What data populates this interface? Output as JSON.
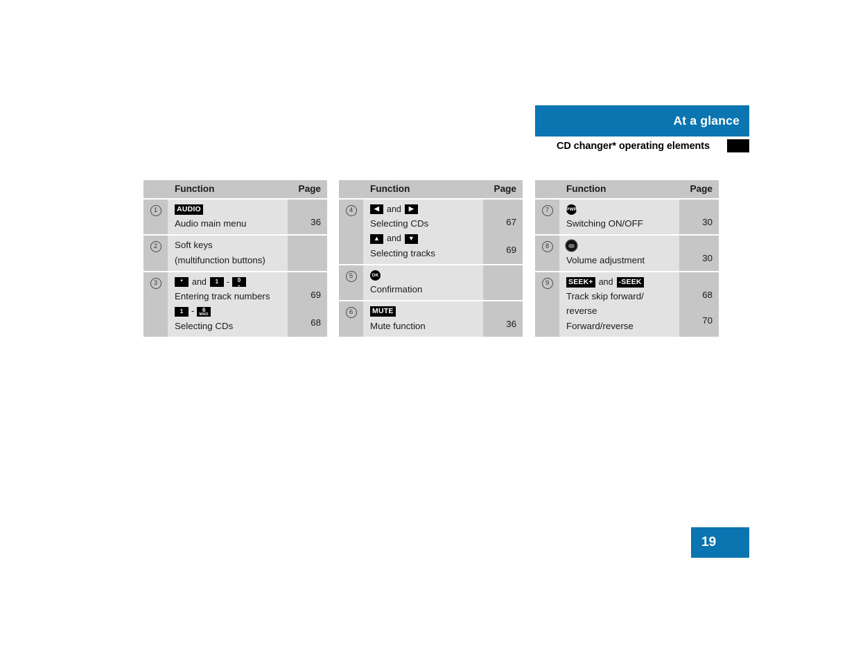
{
  "header": {
    "band_title": "At a glance",
    "subhead_title": "CD changer* operating elements",
    "accent_color": "#0a75b0"
  },
  "table_headers": {
    "function": "Function",
    "page": "Page"
  },
  "tables": [
    {
      "id": "table-1",
      "rows": [
        {
          "num": "1",
          "glyph_line": {
            "kind": "chip-text",
            "items": [
              {
                "type": "chip-text",
                "label": "AUDIO"
              }
            ]
          },
          "lines": [
            {
              "text": "Audio main menu",
              "page": "36"
            }
          ]
        },
        {
          "num": "2",
          "glyph_line": null,
          "lines": [
            {
              "text": "Soft keys",
              "page": ""
            },
            {
              "text": "(multifunction buttons)",
              "page": ""
            }
          ]
        },
        {
          "num": "3",
          "glyph_line": {
            "kind": "keys",
            "items": [
              {
                "type": "chip-key",
                "main": "*",
                "sub": ""
              },
              {
                "type": "word",
                "label": "and"
              },
              {
                "type": "chip-key",
                "main": "1",
                "sub": ""
              },
              {
                "type": "word",
                "label": "-"
              },
              {
                "type": "chip-key",
                "main": "0",
                "sub": "␣"
              }
            ]
          },
          "lines": [
            {
              "text": "Entering track numbers",
              "page": "69"
            }
          ],
          "glyph_line2": {
            "kind": "keys",
            "items": [
              {
                "type": "chip-key",
                "main": "1",
                "sub": ""
              },
              {
                "type": "word",
                "label": "-"
              },
              {
                "type": "chip-key",
                "main": "6",
                "sub": "MNO"
              }
            ]
          },
          "lines2": [
            {
              "text": "Selecting CDs",
              "page": "68"
            }
          ]
        }
      ]
    },
    {
      "id": "table-2",
      "rows": [
        {
          "num": "4",
          "glyph_line": {
            "kind": "keys",
            "items": [
              {
                "type": "chip-arrow",
                "label": "◀"
              },
              {
                "type": "word",
                "label": "and"
              },
              {
                "type": "chip-arrow",
                "label": "▶"
              }
            ]
          },
          "lines": [
            {
              "text": "Selecting CDs",
              "page": "67"
            }
          ],
          "glyph_line2": {
            "kind": "keys",
            "items": [
              {
                "type": "chip-arrow",
                "label": "▲"
              },
              {
                "type": "word",
                "label": "and"
              },
              {
                "type": "chip-arrow",
                "label": "▼"
              }
            ]
          },
          "lines2": [
            {
              "text": "Selecting tracks",
              "page": "69"
            }
          ]
        },
        {
          "num": "5",
          "glyph_line": {
            "kind": "round",
            "items": [
              {
                "type": "chip-round",
                "label": "OK"
              }
            ]
          },
          "lines": [
            {
              "text": "Confirmation",
              "page": ""
            }
          ]
        },
        {
          "num": "6",
          "glyph_line": {
            "kind": "chip-text",
            "items": [
              {
                "type": "chip-text",
                "label": "MUTE"
              }
            ]
          },
          "lines": [
            {
              "text": "Mute function",
              "page": "36"
            }
          ]
        }
      ]
    },
    {
      "id": "table-3",
      "rows": [
        {
          "num": "7",
          "glyph_line": {
            "kind": "round",
            "items": [
              {
                "type": "chip-round",
                "label": "PWR"
              }
            ]
          },
          "lines": [
            {
              "text": "Switching ON/OFF",
              "page": "30"
            }
          ]
        },
        {
          "num": "8",
          "glyph_line": {
            "kind": "knob",
            "items": [
              {
                "type": "knob",
                "label": ""
              }
            ]
          },
          "lines": [
            {
              "text": "Volume adjustment",
              "page": "30"
            }
          ]
        },
        {
          "num": "9",
          "glyph_line": {
            "kind": "chip-text",
            "items": [
              {
                "type": "chip-text",
                "label": "SEEK+"
              },
              {
                "type": "word",
                "label": "and"
              },
              {
                "type": "chip-text",
                "label": "-SEEK"
              }
            ]
          },
          "lines": [
            {
              "text": "Track skip forward/",
              "page": "68"
            },
            {
              "text": "reverse",
              "page": ""
            }
          ],
          "lines2": [
            {
              "text": "Forward/reverse",
              "page": "70"
            }
          ]
        }
      ]
    }
  ],
  "page_badge": {
    "number": "19"
  }
}
